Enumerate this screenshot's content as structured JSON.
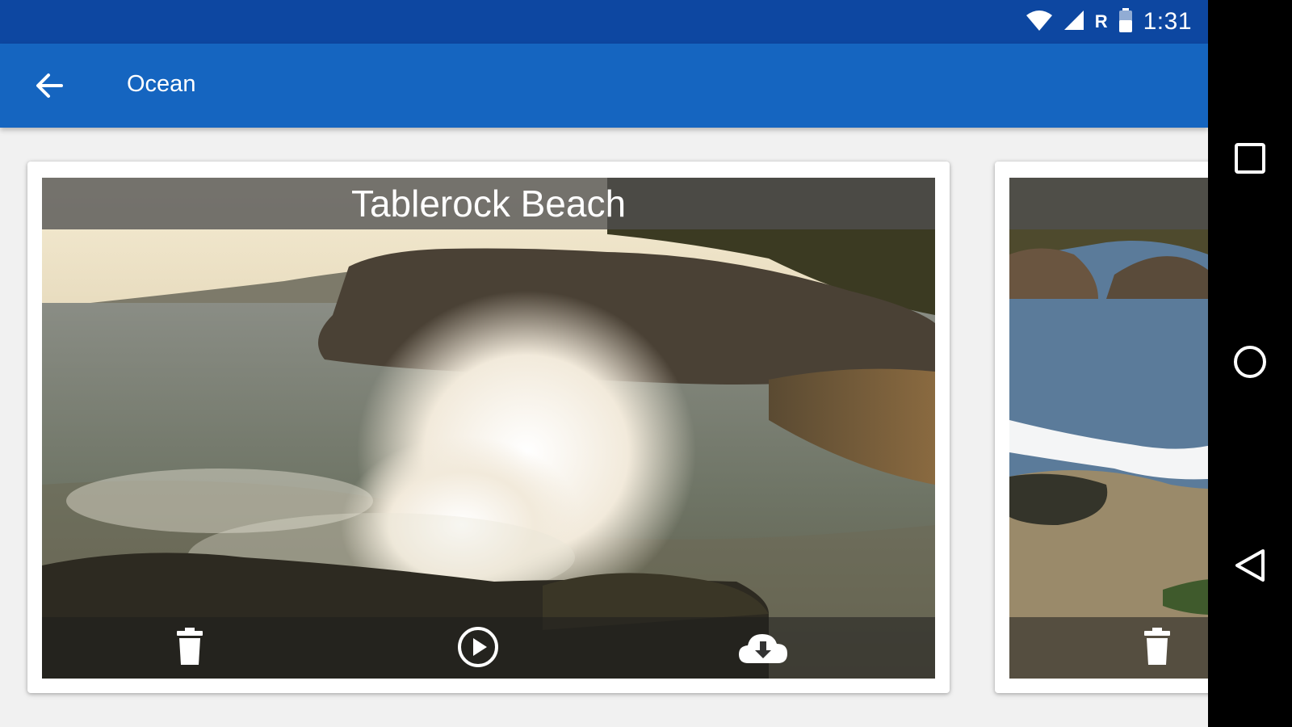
{
  "status_bar": {
    "time": "1:31",
    "roaming_label": "R",
    "icons": [
      "wifi-icon",
      "cell-signal-icon",
      "battery-icon"
    ]
  },
  "app_bar": {
    "title": "Ocean",
    "back_icon": "arrow-back-icon",
    "color": "#1565c0",
    "status_color": "#0d47a1"
  },
  "cards": [
    {
      "title": "Tablerock Beach",
      "actions": [
        "delete-icon",
        "play-icon",
        "download-icon"
      ]
    },
    {
      "title": "",
      "actions": [
        "delete-icon"
      ]
    }
  ],
  "nav_bar": {
    "buttons": [
      "recents-icon",
      "home-icon",
      "back-triangle-icon"
    ]
  }
}
